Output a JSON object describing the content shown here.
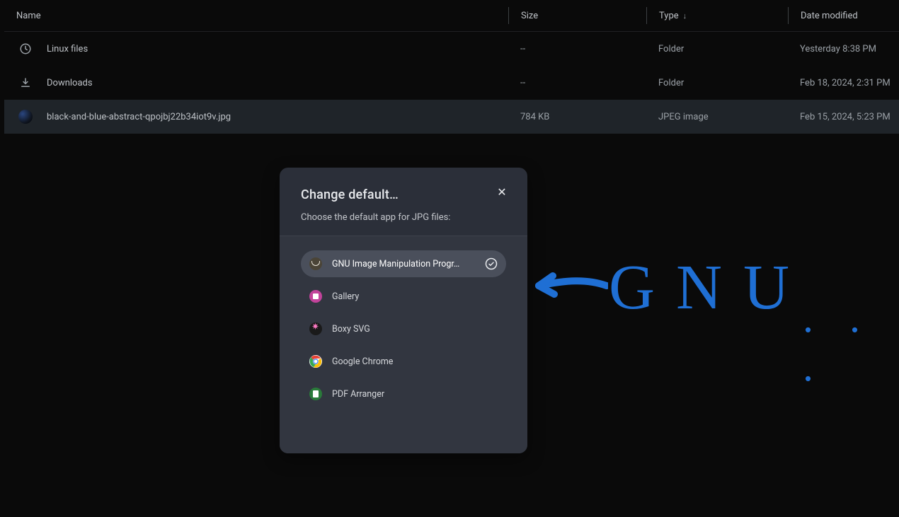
{
  "columns": {
    "name": "Name",
    "size": "Size",
    "type": "Type",
    "date": "Date modified"
  },
  "files": [
    {
      "icon": "clock",
      "name": "Linux files",
      "size": "--",
      "type": "Folder",
      "date": "Yesterday 8:38 PM",
      "selected": false
    },
    {
      "icon": "download",
      "name": "Downloads",
      "size": "--",
      "type": "Folder",
      "date": "Feb 18, 2024, 2:31 PM",
      "selected": false
    },
    {
      "icon": "thumb",
      "name": "black-and-blue-abstract-qpojbj22b34iot9v.jpg",
      "size": "784 KB",
      "type": "JPEG image",
      "date": "Feb 15, 2024, 5:23 PM",
      "selected": true
    }
  ],
  "dialog": {
    "title": "Change default…",
    "subtitle": "Choose the default app for JPG files:",
    "apps": [
      {
        "icon": "gimp",
        "label": "GNU Image Manipulation Progr…",
        "selected": true
      },
      {
        "icon": "gallery",
        "label": "Gallery",
        "selected": false
      },
      {
        "icon": "boxy",
        "label": "Boxy SVG",
        "selected": false
      },
      {
        "icon": "chrome",
        "label": "Google Chrome",
        "selected": false
      },
      {
        "icon": "pdf",
        "label": "PDF Arranger",
        "selected": false
      }
    ]
  },
  "annotation": {
    "text": "GNU",
    "dots": "…"
  }
}
